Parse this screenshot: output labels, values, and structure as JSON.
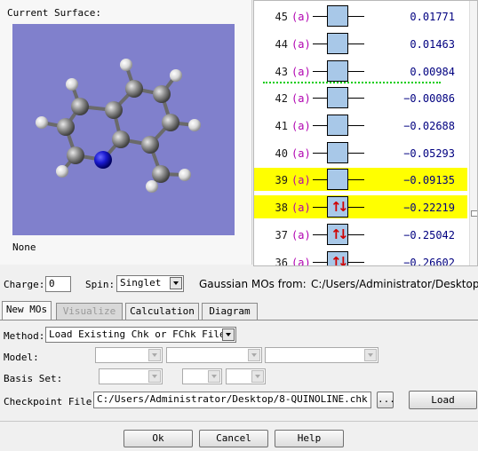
{
  "surface": {
    "title": "Current Surface:",
    "status": "None"
  },
  "mo_list": [
    {
      "num": "45",
      "sym": "(a)",
      "energy": "0.01771",
      "occupied": false,
      "highlight": false
    },
    {
      "num": "44",
      "sym": "(a)",
      "energy": "0.01463",
      "occupied": false,
      "highlight": false
    },
    {
      "num": "43",
      "sym": "(a)",
      "energy": "0.00984",
      "occupied": false,
      "highlight": false
    },
    {
      "num": "42",
      "sym": "(a)",
      "energy": "-0.00086",
      "occupied": false,
      "highlight": false
    },
    {
      "num": "41",
      "sym": "(a)",
      "energy": "-0.02688",
      "occupied": false,
      "highlight": false
    },
    {
      "num": "40",
      "sym": "(a)",
      "energy": "-0.05293",
      "occupied": false,
      "highlight": false
    },
    {
      "num": "39",
      "sym": "(a)",
      "energy": "-0.09135",
      "occupied": false,
      "highlight": true
    },
    {
      "num": "38",
      "sym": "(a)",
      "energy": "-0.22219",
      "occupied": true,
      "highlight": true
    },
    {
      "num": "37",
      "sym": "(a)",
      "energy": "-0.25042",
      "occupied": true,
      "highlight": false
    },
    {
      "num": "36",
      "sym": "(a)",
      "energy": "-0.26602",
      "occupied": true,
      "highlight": false
    }
  ],
  "charge": {
    "label": "Charge:",
    "value": "0"
  },
  "spin": {
    "label": "Spin:",
    "value": "Singlet"
  },
  "source": {
    "label": "Gaussian MOs from:",
    "path": "C:/Users/Administrator/Desktop"
  },
  "tabs": [
    "New MOs",
    "Visualize",
    "Calculation",
    "Diagram"
  ],
  "form": {
    "method_label": "Method:",
    "method_value": "Load Existing Chk or FChk File",
    "model_label": "Model:",
    "basis_label": "Basis Set:",
    "checkpoint_label": "Checkpoint File:",
    "checkpoint_value": "C:/Users/Administrator/Desktop/8-QUINOLINE.chk",
    "browse_label": "...",
    "load_label": "Load"
  },
  "buttons": {
    "ok": "Ok",
    "cancel": "Cancel",
    "help": "Help"
  },
  "colors": {
    "viewer_bg": "#8080cc",
    "highlight": "#ffff00",
    "orbital_fill": "#a8c8e8",
    "homo_lumo_divider": "#00cc00"
  }
}
